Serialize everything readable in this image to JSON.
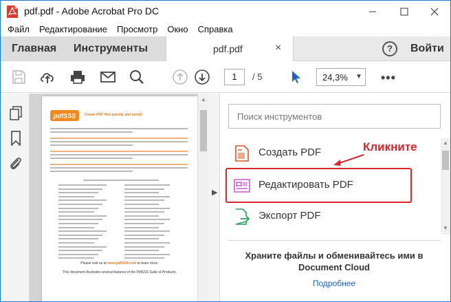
{
  "window": {
    "title": "pdf.pdf - Adobe Acrobat Pro DC"
  },
  "menu": {
    "items": [
      "Файл",
      "Редактирование",
      "Просмотр",
      "Окно",
      "Справка"
    ]
  },
  "tabs": {
    "home": "Главная",
    "tools": "Инструменты",
    "document": "pdf.pdf",
    "close": "×",
    "help": "?",
    "signin": "Войти"
  },
  "toolbar": {
    "page_current": "1",
    "page_total": "/ 5",
    "zoom": "24,3%",
    "more": "•••"
  },
  "document_page": {
    "logo_text": "pdfSSS",
    "tagline": "Create PDF files quickly and easily!",
    "caption_prefix": "Please visit us at",
    "caption_link": "www.pdfSSS.com",
    "caption_suffix": "to learn more.",
    "footer": "This document illustrates several features of the PdfSSS Suite of Products."
  },
  "tools_panel": {
    "search_placeholder": "Поиск инструментов",
    "items": [
      {
        "label": "Создать PDF",
        "icon": "create-pdf-icon"
      },
      {
        "label": "Редактировать PDF",
        "icon": "edit-pdf-icon"
      },
      {
        "label": "Экспорт PDF",
        "icon": "export-pdf-icon"
      }
    ],
    "cloud_text": "Храните файлы и обменивайтесь ими в Document Cloud",
    "cloud_link": "Подробнее"
  },
  "annotation": {
    "text": "Кликните",
    "color": "#d8242b"
  },
  "colors": {
    "accent": "#1a64c8",
    "window_border": "#1e78c8",
    "highlight": "#d8242b"
  }
}
